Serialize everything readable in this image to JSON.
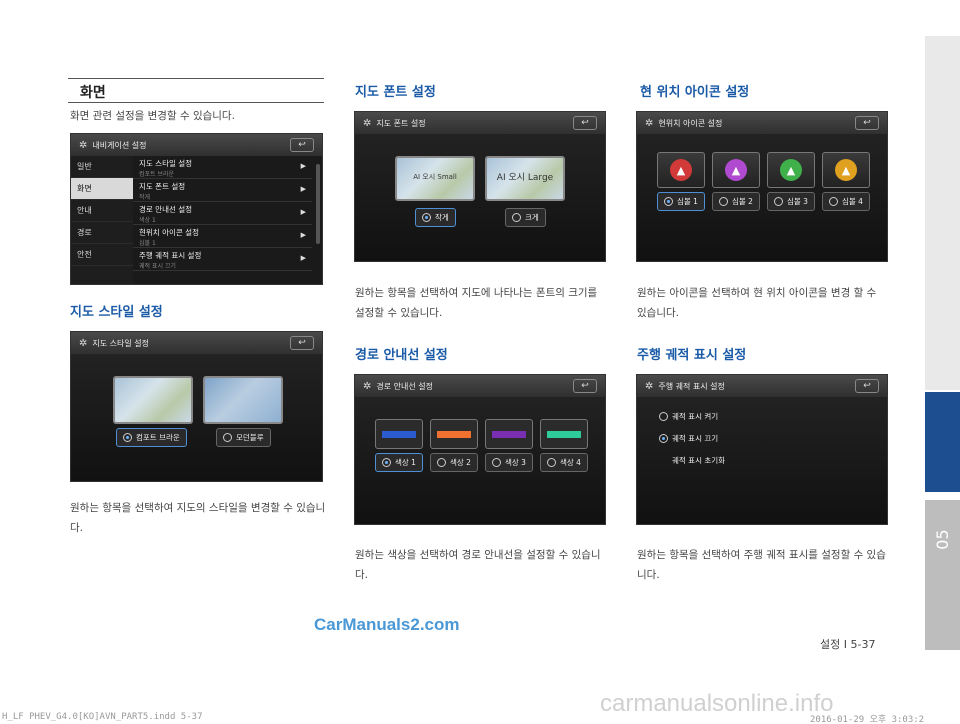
{
  "sidebar": {
    "chapter_number": "05"
  },
  "page": {
    "label": "설정 I 5-37"
  },
  "col1": {
    "main_heading": "화면",
    "main_desc": "화면 관련 설정을 변경할 수 있습니다.",
    "nav_screen": {
      "title": "내비게이션 설정",
      "menu": [
        "일반",
        "화면",
        "안내",
        "경로",
        "안전"
      ],
      "rows": [
        {
          "title": "지도 스타일 설정",
          "sub": "컴포트 브라운"
        },
        {
          "title": "지도 폰트 설정",
          "sub": "작게"
        },
        {
          "title": "경로 안내선 설정",
          "sub": "색상 1"
        },
        {
          "title": "현위치 아이콘 설정",
          "sub": "심볼 1"
        },
        {
          "title": "주행 궤적 표시 설정",
          "sub": "궤적 표시 끄기"
        }
      ]
    },
    "style_heading": "지도 스타일 설정",
    "style_screen": {
      "title": "지도 스타일 설정",
      "opt1": "컴포트 브라운",
      "opt2": "모던블루"
    },
    "style_desc": "원하는 항목을 선택하여 지도의 스타일을 변경할 수 있습니다."
  },
  "col2": {
    "font_heading": "지도 폰트 설정",
    "font_screen": {
      "title": "지도 폰트 설정",
      "opt1": "작게",
      "opt2": "크게",
      "map1": "AI 오시 Small",
      "map2": "AI 오시 Large"
    },
    "font_desc": "원하는 항목을 선택하여 지도에 나타나는 폰트의 크기를 설정할 수 있습니다.",
    "route_heading": "경로 안내선 설정",
    "route_screen": {
      "title": "경로 안내선 설정",
      "options": [
        "색상 1",
        "색상 2",
        "색상 3",
        "색상 4"
      ],
      "colors": [
        "#2a5bd1",
        "#f07030",
        "#7a2fb3",
        "#2ecc9a"
      ]
    },
    "route_desc": "원하는 색상을 선택하여 경로 안내선을 설정할 수 있습니다."
  },
  "col3": {
    "icon_heading": "현 위치 아이콘 설정",
    "icon_screen": {
      "title": "현위치 아이콘 설정",
      "options": [
        "심볼 1",
        "심볼 2",
        "심볼 3",
        "심볼 4"
      ],
      "colors": [
        "#d23a3a",
        "#b04ad0",
        "#3fb04a",
        "#e0a020"
      ]
    },
    "icon_desc": "원하는 아이콘을 선택하여 현 위치 아이콘을 변경 할 수 있습니다.",
    "track_heading": "주행 궤적 표시 설정",
    "track_screen": {
      "title": "주행 궤적 표시 설정",
      "opt1": "궤적 표시 켜기",
      "opt2": "궤적 표시 끄기",
      "opt3": "궤적 표시 초기화"
    },
    "track_desc": "원하는 항목을 선택하여 주행 궤적 표시를 설정할 수 있습니다."
  },
  "watermark": "CarManuals2.com",
  "footer": {
    "file": "H_LF PHEV_G4.0[KO]AVN_PART5.indd   5-37",
    "date": "2016-01-29   오후 3:03:2",
    "site": "carmanualsonline.info"
  }
}
